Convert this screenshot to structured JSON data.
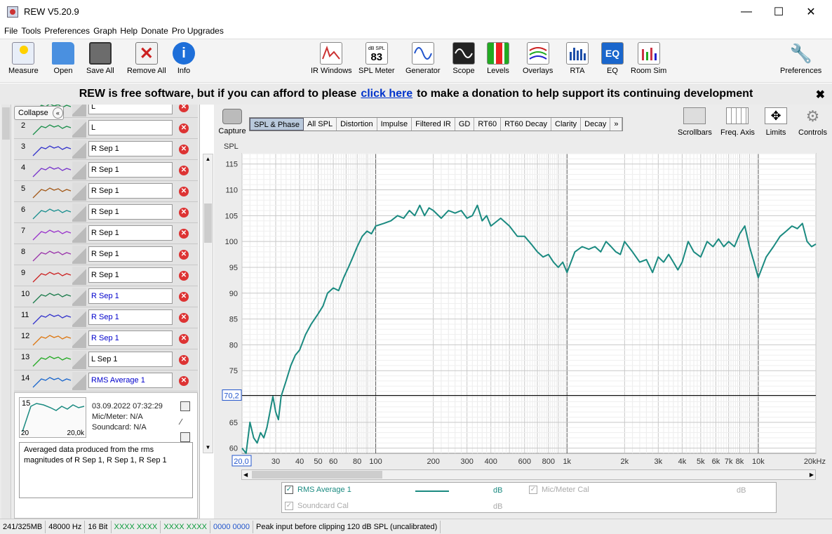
{
  "window": {
    "title": "REW V5.20.9"
  },
  "menu": [
    "File",
    "Tools",
    "Preferences",
    "Graph",
    "Help",
    "Donate",
    "Pro Upgrades"
  ],
  "toolbar": {
    "left": [
      {
        "label": "Measure",
        "icon": "measure-icon",
        "color": "#3a7bd5"
      },
      {
        "label": "Open",
        "icon": "folder-open-icon",
        "color": "#2f7bd8"
      },
      {
        "label": "Save All",
        "icon": "save-all-icon",
        "color": "#555555"
      },
      {
        "label": "Remove All",
        "icon": "remove-all-icon",
        "color": "#b33030"
      },
      {
        "label": "Info",
        "icon": "info-icon",
        "color": "#1e6fd9"
      }
    ],
    "center": [
      {
        "label": "IR Windows",
        "icon": "ir-windows-icon",
        "color": "#cc3333"
      },
      {
        "label": "SPL Meter",
        "icon": "spl-meter-icon",
        "color": "#333333",
        "display_small": "dB SPL",
        "display_value": "83"
      },
      {
        "label": "Generator",
        "icon": "generator-icon",
        "color": "#2255cc"
      },
      {
        "label": "Scope",
        "icon": "scope-icon",
        "color": "#222222"
      },
      {
        "label": "Levels",
        "icon": "levels-icon",
        "color": "#cc2222"
      },
      {
        "label": "Overlays",
        "icon": "overlays-icon",
        "color": "#2288aa"
      },
      {
        "label": "RTA",
        "icon": "rta-icon",
        "color": "#1e4fa8"
      },
      {
        "label": "EQ",
        "icon": "eq-icon",
        "color": "#1a66cc"
      },
      {
        "label": "Room Sim",
        "icon": "room-sim-icon",
        "color": "#cc3344"
      }
    ],
    "right": {
      "label": "Preferences",
      "icon": "wrench-icon"
    }
  },
  "banner": {
    "before": "REW is free software, but if you can afford to please",
    "link": "click here",
    "after": "to make a donation to help support its continuing development"
  },
  "panel": {
    "collapse_label": "Collapse",
    "measurements": [
      {
        "num": "",
        "name": "L",
        "color": "#1a8f4a",
        "blue": false
      },
      {
        "num": "2",
        "name": "L",
        "color": "#1a8f4a",
        "blue": false
      },
      {
        "num": "3",
        "name": "R Sep 1",
        "color": "#3333cc",
        "blue": false
      },
      {
        "num": "4",
        "name": "R Sep 1",
        "color": "#7733cc",
        "blue": false
      },
      {
        "num": "5",
        "name": "R Sep 1",
        "color": "#a35a1a",
        "blue": false
      },
      {
        "num": "6",
        "name": "R Sep 1",
        "color": "#1a8f8f",
        "blue": false
      },
      {
        "num": "7",
        "name": "R Sep 1",
        "color": "#9933cc",
        "blue": false
      },
      {
        "num": "8",
        "name": "R Sep 1",
        "color": "#9933aa",
        "blue": false
      },
      {
        "num": "9",
        "name": "R Sep 1",
        "color": "#cc2222",
        "blue": false
      },
      {
        "num": "10",
        "name": "R Sep 1",
        "color": "#1a7a4a",
        "blue": true
      },
      {
        "num": "11",
        "name": "R Sep 1",
        "color": "#3333cc",
        "blue": true
      },
      {
        "num": "12",
        "name": "R Sep 1",
        "color": "#dd7711",
        "blue": true
      },
      {
        "num": "13",
        "name": "L Sep 1",
        "color": "#22aa22",
        "blue": false
      },
      {
        "num": "14",
        "name": "RMS Average 1",
        "color": "#1a66cc",
        "blue": true
      }
    ],
    "detail": {
      "num": "15",
      "thumb_min": "20",
      "thumb_max": "20,0k",
      "date": "03.09.2022 07:32:29",
      "mic": "Mic/Meter: N/A",
      "soundcard": "Soundcard: N/A",
      "note": "Averaged data produced from the rms magnitudes of R Sep 1, R Sep 1, R Sep 1"
    }
  },
  "graph": {
    "capture_label": "Capture",
    "tabs": [
      "SPL & Phase",
      "All SPL",
      "Distortion",
      "Impulse",
      "Filtered IR",
      "GD",
      "RT60",
      "RT60 Decay",
      "Clarity",
      "Decay",
      "»"
    ],
    "active_tab": 0,
    "tools": [
      "Scrollbars",
      "Freq. Axis",
      "Limits",
      "Controls"
    ],
    "cursor_y": "70,2",
    "cursor_x": "20,0"
  },
  "chart_data": {
    "type": "line",
    "ylabel": "SPL",
    "xlabel": "",
    "x_scale": "log",
    "xlim": [
      20,
      20000
    ],
    "ylim": [
      59,
      117
    ],
    "y_ticks": [
      60,
      65,
      70,
      75,
      80,
      85,
      90,
      95,
      100,
      105,
      110,
      115
    ],
    "x_ticks": [
      {
        "v": 30,
        "t": "30"
      },
      {
        "v": 40,
        "t": "40"
      },
      {
        "v": 50,
        "t": "50"
      },
      {
        "v": 60,
        "t": "60"
      },
      {
        "v": 80,
        "t": "80"
      },
      {
        "v": 100,
        "t": "100"
      },
      {
        "v": 200,
        "t": "200"
      },
      {
        "v": 300,
        "t": "300"
      },
      {
        "v": 400,
        "t": "400"
      },
      {
        "v": 600,
        "t": "600"
      },
      {
        "v": 800,
        "t": "800"
      },
      {
        "v": 1000,
        "t": "1k"
      },
      {
        "v": 2000,
        "t": "2k"
      },
      {
        "v": 3000,
        "t": "3k"
      },
      {
        "v": 4000,
        "t": "4k"
      },
      {
        "v": 5000,
        "t": "5k"
      },
      {
        "v": 6000,
        "t": "6k"
      },
      {
        "v": 7000,
        "t": "7k"
      },
      {
        "v": 8000,
        "t": "8k"
      },
      {
        "v": 10000,
        "t": "10k"
      },
      {
        "v": 20000,
        "t": "20kHz"
      }
    ],
    "cursor_level": 70.2,
    "series": [
      {
        "name": "RMS Average 1",
        "color": "#1a8a80",
        "x": [
          20,
          21,
          22,
          23,
          24,
          25,
          26,
          27,
          28,
          29,
          30,
          31,
          32,
          34,
          36,
          38,
          40,
          43,
          46,
          50,
          53,
          56,
          60,
          64,
          68,
          72,
          76,
          80,
          85,
          90,
          95,
          100,
          110,
          120,
          130,
          140,
          150,
          160,
          170,
          180,
          190,
          200,
          220,
          240,
          260,
          280,
          300,
          320,
          340,
          360,
          380,
          400,
          450,
          500,
          550,
          600,
          650,
          700,
          750,
          800,
          850,
          900,
          950,
          1000,
          1100,
          1200,
          1300,
          1400,
          1500,
          1600,
          1700,
          1800,
          1900,
          2000,
          2200,
          2400,
          2600,
          2800,
          3000,
          3200,
          3400,
          3600,
          3800,
          4000,
          4300,
          4600,
          5000,
          5400,
          5800,
          6200,
          6600,
          7000,
          7500,
          8000,
          8500,
          9000,
          9500,
          10000,
          11000,
          12000,
          13000,
          14000,
          15000,
          16000,
          17000,
          18000,
          19000,
          20000
        ],
        "values": [
          60,
          58,
          65,
          62,
          61,
          63,
          62,
          64,
          67,
          70,
          67,
          65.5,
          70,
          73,
          76,
          78,
          79,
          82,
          84,
          86,
          87.5,
          90,
          91,
          90.5,
          93,
          95,
          97,
          99,
          101,
          102,
          101.5,
          103,
          103.5,
          104,
          105,
          104.5,
          106,
          105,
          107,
          105,
          106.5,
          106,
          104.5,
          106,
          105.5,
          106,
          104.5,
          105,
          107,
          104,
          105,
          103,
          104.5,
          103,
          101,
          101,
          99.5,
          98,
          97,
          97.5,
          96,
          95,
          96,
          94,
          98,
          99,
          98.5,
          99,
          98,
          100,
          99,
          98,
          97.5,
          100,
          98,
          96,
          96.5,
          94,
          97,
          96,
          97.5,
          96,
          94.5,
          96,
          100,
          98,
          97,
          100,
          99,
          100.5,
          99,
          100,
          99,
          101.5,
          103,
          99,
          96,
          93,
          97,
          99,
          101,
          102,
          103,
          102.5,
          103.5,
          100,
          99,
          99.5
        ]
      }
    ]
  },
  "legend": {
    "rows": [
      {
        "label": "RMS Average 1",
        "unit": "dB",
        "checked": true,
        "disabled": false
      },
      {
        "label": "Mic/Meter Cal",
        "unit": "dB",
        "checked": true,
        "disabled": true
      },
      {
        "label": "Soundcard Cal",
        "unit": "dB",
        "checked": true,
        "disabled": true
      }
    ]
  },
  "status": {
    "memory": "241/325MB",
    "rate": "48000 Hz",
    "bits": "16 Bit",
    "in_meter": "XXXX XXXX",
    "out_meter": "XXXX XXXX",
    "zero": "0000 0000",
    "message": "Peak input before clipping 120 dB SPL (uncalibrated)"
  }
}
